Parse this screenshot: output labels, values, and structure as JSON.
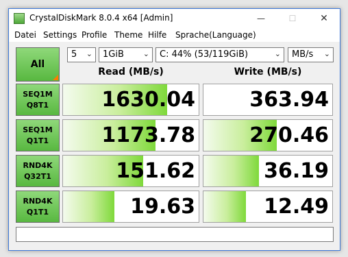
{
  "window": {
    "title": "CrystalDiskMark 8.0.4 x64 [Admin]",
    "controls": {
      "minimize": "—",
      "maximize": "☐",
      "close": "✕"
    }
  },
  "menu": [
    "Datei",
    "Settings",
    "Profile",
    "Theme",
    "Hilfe",
    "Sprache(Language)"
  ],
  "toolbar": {
    "all_label": "All",
    "count": "5",
    "size": "1GiB",
    "drive": "C: 44% (53/119GiB)",
    "unit": "MB/s"
  },
  "headers": {
    "read": "Read (MB/s)",
    "write": "Write (MB/s)"
  },
  "rows": [
    {
      "test_line1": "SEQ1M",
      "test_line2": "Q8T1",
      "read": "1630.04",
      "write": "363.94",
      "read_fill": 0.77,
      "write_fill": 0.0
    },
    {
      "test_line1": "SEQ1M",
      "test_line2": "Q1T1",
      "read": "1173.78",
      "write": "270.46",
      "read_fill": 0.68,
      "write_fill": 0.57
    },
    {
      "test_line1": "RND4K",
      "test_line2": "Q32T1",
      "read": "151.62",
      "write": "36.19",
      "read_fill": 0.59,
      "write_fill": 0.43
    },
    {
      "test_line1": "RND4K",
      "test_line2": "Q1T1",
      "read": "19.63",
      "write": "12.49",
      "read_fill": 0.38,
      "write_fill": 0.33
    }
  ],
  "comment": ""
}
